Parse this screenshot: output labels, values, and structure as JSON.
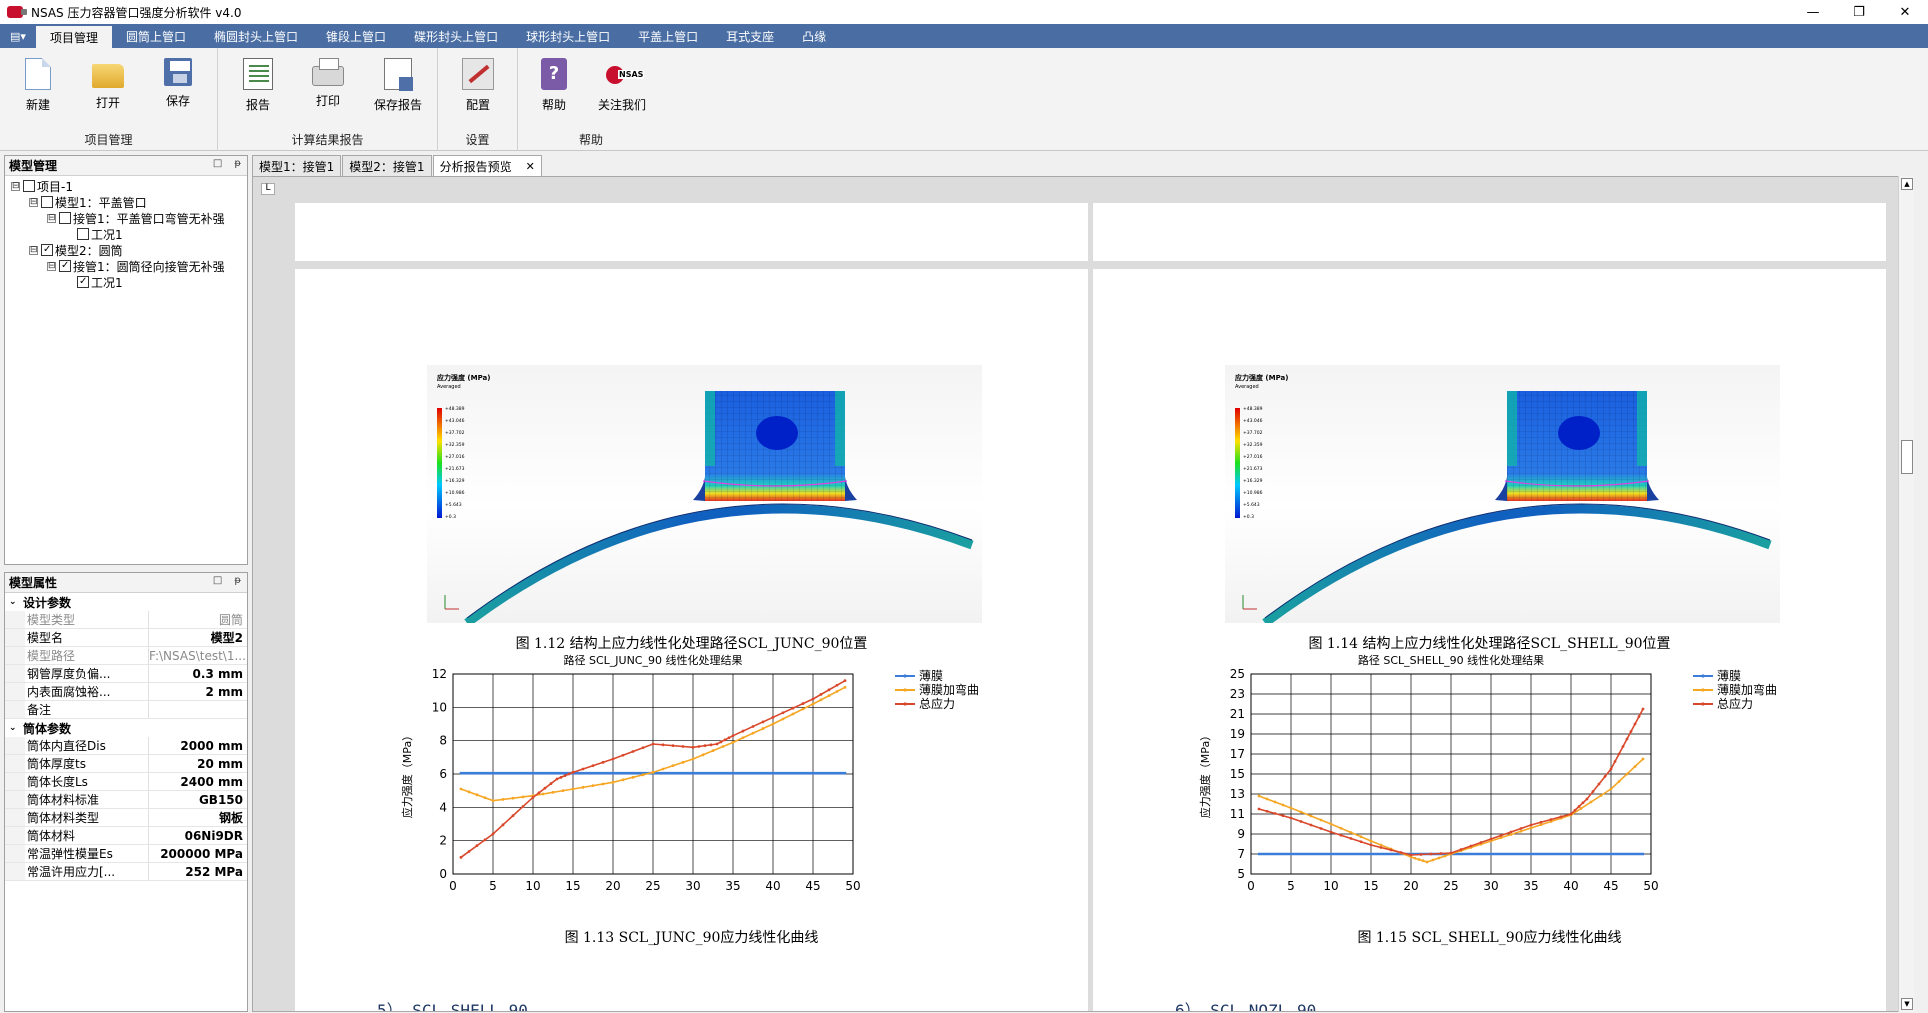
{
  "window": {
    "title": "NSAS 压力容器管口强度分析软件 v4.0",
    "minimize": "—",
    "restore": "❐",
    "close": "✕"
  },
  "menu": {
    "app_button": "▤▾",
    "tabs": [
      "项目管理",
      "圆筒上管口",
      "椭圆封头上管口",
      "锥段上管口",
      "碟形封头上管口",
      "球形封头上管口",
      "平盖上管口",
      "耳式支座",
      "凸缘"
    ]
  },
  "ribbon": {
    "groups": {
      "project": "项目管理",
      "report": "计算结果报告",
      "settings": "设置",
      "help": "帮助"
    },
    "buttons": {
      "new": "新建",
      "open": "打开",
      "save": "保存",
      "report": "报告",
      "print": "打印",
      "save_report": "保存报告",
      "config": "配置",
      "help": "帮助",
      "follow": "关注我们"
    }
  },
  "model_panel": {
    "title": "模型管理",
    "pin": "□",
    "close": "ᵽ",
    "tree": [
      {
        "label": "项目-1",
        "level": 0,
        "checked": false,
        "expander": "⊟"
      },
      {
        "label": "模型1：平盖管口",
        "level": 1,
        "checked": false,
        "expander": "⊟"
      },
      {
        "label": "接管1：平盖管口弯管无补强",
        "level": 2,
        "checked": false,
        "expander": "⊟"
      },
      {
        "label": "工况1",
        "level": 3,
        "checked": false,
        "expander": ""
      },
      {
        "label": "模型2：圆筒",
        "level": 1,
        "checked": true,
        "expander": "⊟"
      },
      {
        "label": "接管1：圆筒径向接管无补强",
        "level": 2,
        "checked": true,
        "expander": "⊟"
      },
      {
        "label": "工况1",
        "level": 3,
        "checked": true,
        "expander": ""
      }
    ]
  },
  "props_panel": {
    "title": "模型属性",
    "pin": "□",
    "close": "ᵽ",
    "categories": [
      {
        "name": "设计参数",
        "rows": [
          {
            "k": "模型类型",
            "v": "圆筒",
            "disabled": true
          },
          {
            "k": "模型名",
            "v": "模型2",
            "disabled": false
          },
          {
            "k": "模型路径",
            "v": "F:\\NSAS\\test\\1...",
            "disabled": true
          },
          {
            "k": "钢管厚度负偏...",
            "v": "0.3 mm",
            "disabled": false
          },
          {
            "k": "内表面腐蚀裕...",
            "v": "2 mm",
            "disabled": false
          },
          {
            "k": "备注",
            "v": "",
            "disabled": false
          }
        ]
      },
      {
        "name": "筒体参数",
        "rows": [
          {
            "k": "筒体内直径Dis",
            "v": "2000 mm",
            "disabled": false
          },
          {
            "k": "筒体厚度ts",
            "v": "20 mm",
            "disabled": false
          },
          {
            "k": "筒体长度Ls",
            "v": "2400 mm",
            "disabled": false
          },
          {
            "k": "筒体材料标准",
            "v": "GB150",
            "disabled": false
          },
          {
            "k": "筒体材料类型",
            "v": "钢板",
            "disabled": false
          },
          {
            "k": "筒体材料",
            "v": "06Ni9DR",
            "disabled": false
          },
          {
            "k": "常温弹性模量Es",
            "v": "200000 MPa",
            "disabled": false
          },
          {
            "k": "常温许用应力[...",
            "v": "252 MPa",
            "disabled": false
          }
        ]
      }
    ]
  },
  "doc_tabs": [
    "模型1：接管1",
    "模型2：接管1",
    "分析报告预览"
  ],
  "doc_tab_close": "✕",
  "preview": {
    "corner": "L",
    "scroll_up": "▲",
    "scroll_down": "▼",
    "left_page": {
      "fea_caption": "图 1.12 结构上应力线性化处理路径SCL_JUNC_90位置",
      "chart_caption": "图 1.13 SCL_JUNC_90应力线性化曲线",
      "section_head": "5） SCL_SHELL_90"
    },
    "right_page": {
      "fea_caption": "图 1.14 结构上应力线性化处理路径SCL_SHELL_90位置",
      "chart_caption": "图 1.15 SCL_SHELL_90应力线性化曲线",
      "section_head": "6） SCL_NOZL_90"
    },
    "fea_legend_title": "应力强度 (MPa)",
    "fea_legend_sub": "Averaged",
    "fea_legend_values": [
      "+48.389",
      "+43.046",
      "+37.702",
      "+32.359",
      "+27.016",
      "+21.673",
      "+16.329",
      "+10.986",
      "+5.643",
      "+0.3"
    ]
  },
  "chart_data": [
    {
      "type": "line",
      "title": "路径 SCL_JUNC_90 线性化处理结果",
      "xlabel": "",
      "ylabel": "应力强度（MPa）",
      "xlim": [
        0,
        50
      ],
      "ylim": [
        0,
        12
      ],
      "xticks": [
        0,
        5,
        10,
        15,
        20,
        25,
        30,
        35,
        40,
        45,
        50
      ],
      "yticks": [
        0,
        2,
        4,
        6,
        8,
        10,
        12
      ],
      "grid": true,
      "legend": "right",
      "series": [
        {
          "name": "薄膜",
          "color": "#3b7dd8",
          "x": [
            1,
            49
          ],
          "y": [
            6.05,
            6.05
          ],
          "kind": "flat"
        },
        {
          "name": "薄膜加弯曲",
          "color": "#f5a623",
          "x": [
            1,
            5,
            10,
            15,
            20,
            25,
            30,
            35,
            40,
            45,
            49
          ],
          "y": [
            5.1,
            4.4,
            4.7,
            5.1,
            5.5,
            6.1,
            6.9,
            7.9,
            9.0,
            10.2,
            11.2
          ]
        },
        {
          "name": "总应力",
          "color": "#d9482b",
          "x": [
            1,
            5,
            10,
            13,
            15,
            20,
            25,
            30,
            33,
            35,
            40,
            45,
            49
          ],
          "y": [
            1.0,
            2.4,
            4.6,
            5.7,
            6.1,
            6.9,
            7.8,
            7.6,
            7.8,
            8.3,
            9.4,
            10.5,
            11.6
          ]
        }
      ]
    },
    {
      "type": "line",
      "title": "路径 SCL_SHELL_90 线性化处理结果",
      "xlabel": "",
      "ylabel": "应力强度（MPa）",
      "xlim": [
        0,
        50
      ],
      "ylim": [
        5,
        25
      ],
      "xticks": [
        0,
        5,
        10,
        15,
        20,
        25,
        30,
        35,
        40,
        45,
        50
      ],
      "yticks": [
        5,
        7,
        9,
        11,
        13,
        15,
        17,
        19,
        21,
        23,
        25
      ],
      "grid": true,
      "legend": "right",
      "series": [
        {
          "name": "薄膜",
          "color": "#3b7dd8",
          "x": [
            1,
            49
          ],
          "y": [
            7.0,
            7.0
          ],
          "kind": "flat"
        },
        {
          "name": "薄膜加弯曲",
          "color": "#f5a623",
          "x": [
            1,
            5,
            10,
            15,
            20,
            22,
            25,
            30,
            35,
            40,
            45,
            49
          ],
          "y": [
            12.8,
            11.6,
            10.0,
            8.3,
            6.7,
            6.2,
            7.0,
            8.3,
            9.6,
            10.9,
            13.5,
            16.5
          ]
        },
        {
          "name": "总应力",
          "color": "#d9482b",
          "x": [
            1,
            5,
            10,
            15,
            20,
            25,
            30,
            35,
            40,
            42,
            45,
            47,
            49
          ],
          "y": [
            11.5,
            10.6,
            9.2,
            7.9,
            6.9,
            7.1,
            8.5,
            9.9,
            11.0,
            12.5,
            15.5,
            18.5,
            21.5
          ]
        }
      ]
    }
  ]
}
